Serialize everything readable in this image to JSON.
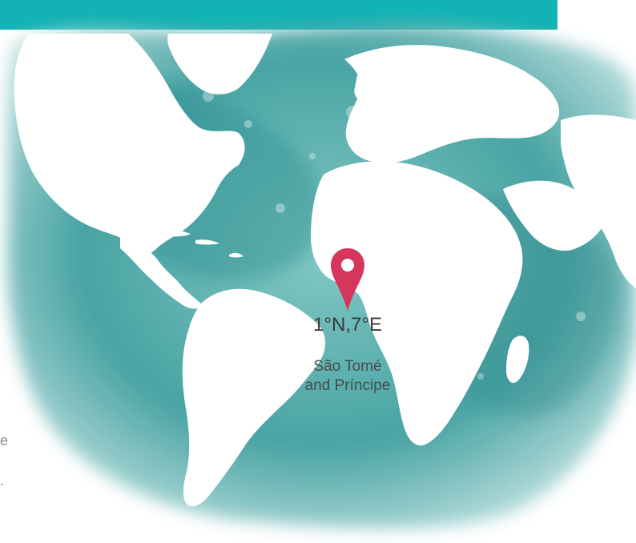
{
  "header": {
    "color": "#12b2b5"
  },
  "map": {
    "ocean_color": "#2e9ea0",
    "land_color": "#ffffff",
    "marker": {
      "icon": "map-pin-icon",
      "color": "#d6365b",
      "coordinates": "1°N,7°E",
      "place_line1": "São Tomé",
      "place_line2": "and Príncipe"
    }
  },
  "edge_text": {
    "line1": "e",
    "line2": "."
  }
}
